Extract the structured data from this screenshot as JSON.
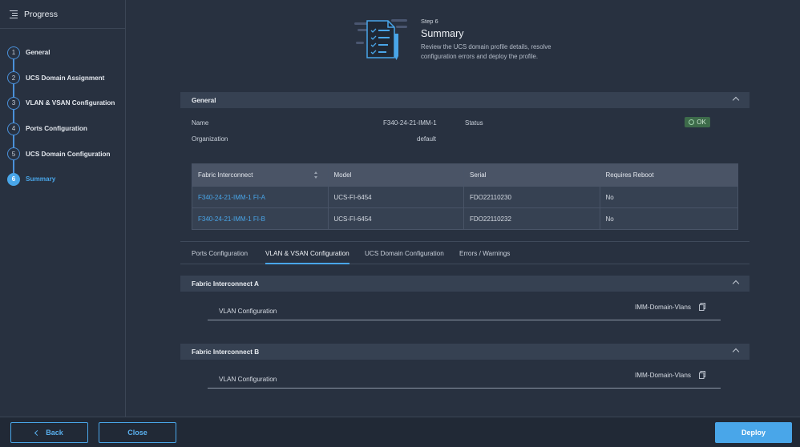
{
  "sidebar": {
    "title": "Progress",
    "steps": [
      {
        "num": "1",
        "label": "General"
      },
      {
        "num": "2",
        "label": "UCS Domain Assignment"
      },
      {
        "num": "3",
        "label": "VLAN & VSAN Configuration"
      },
      {
        "num": "4",
        "label": "Ports Configuration"
      },
      {
        "num": "5",
        "label": "UCS Domain Configuration"
      },
      {
        "num": "6",
        "label": "Summary"
      }
    ],
    "active_step": "6"
  },
  "hero": {
    "step": "Step 6",
    "title": "Summary",
    "description": "Review the UCS domain profile details, resolve configuration errors and deploy the profile."
  },
  "general": {
    "section_title": "General",
    "name_label": "Name",
    "name_value": "F340-24-21-IMM-1",
    "organization_label": "Organization",
    "organization_value": "default",
    "status_label": "Status",
    "status_value": "OK",
    "status_color": "#3d6b4a"
  },
  "fi_table": {
    "columns": [
      "Fabric Interconnect",
      "Model",
      "Serial",
      "Requires Reboot"
    ],
    "rows": [
      {
        "fi": "F340-24-21-IMM-1 FI-A",
        "model": "UCS-FI-6454",
        "serial": "FDO22110230",
        "reboot": "No"
      },
      {
        "fi": "F340-24-21-IMM-1 FI-B",
        "model": "UCS-FI-6454",
        "serial": "FDO22110232",
        "reboot": "No"
      }
    ]
  },
  "tabs": [
    {
      "label": "Ports Configuration"
    },
    {
      "label": "VLAN & VSAN Configuration"
    },
    {
      "label": "UCS Domain Configuration"
    },
    {
      "label": "Errors / Warnings"
    }
  ],
  "active_tab": "VLAN & VSAN Configuration",
  "fabric_a": {
    "title": "Fabric Interconnect A",
    "vlan_label": "VLAN Configuration",
    "vlan_value": "IMM-Domain-Vlans"
  },
  "fabric_b": {
    "title": "Fabric Interconnect B",
    "vlan_label": "VLAN Configuration",
    "vlan_value": "IMM-Domain-Vlans"
  },
  "footer": {
    "back_label": "Back",
    "close_label": "Close",
    "deploy_label": "Deploy"
  },
  "colors": {
    "accent": "#49a6e9",
    "background": "#283140",
    "panel": "#364152"
  },
  "icons": {
    "sidebar_toggle": "menu-collapse-icon",
    "hero": "checklist-document-icon",
    "copy": "copy-icon",
    "status_ok": "check-circle-icon",
    "sort": "sort-icon",
    "collapse": "chevron-up-icon",
    "back": "chevron-left-icon"
  }
}
